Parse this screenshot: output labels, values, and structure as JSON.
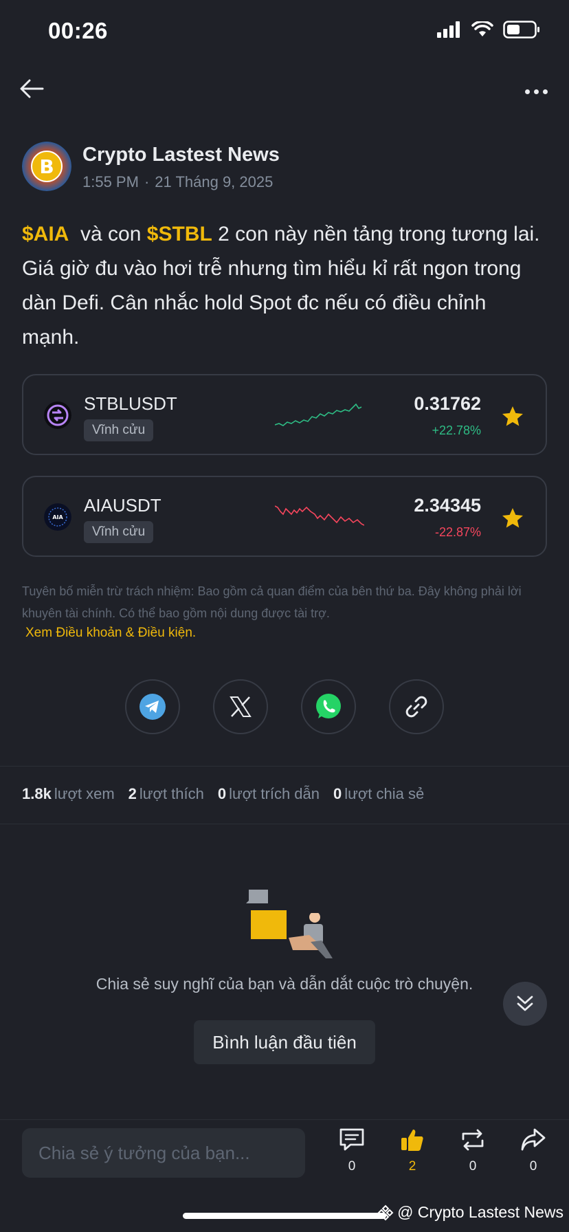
{
  "status_bar": {
    "time": "00:26"
  },
  "author": {
    "name": "Crypto Lastest News",
    "time": "1:55 PM",
    "date": "21 Tháng 9, 2025"
  },
  "post": {
    "tag1": "$AIA",
    "text1": "  và con ",
    "tag2": "$STBL",
    "text2": " 2 con này nền tảng trong tương lai. Giá giờ đu vào hơi trễ nhưng tìm hiểu kỉ rất ngon trong dàn Defi. Cân nhắc hold Spot đc nếu có điều chỉnh mạnh."
  },
  "tickers": [
    {
      "symbol": "STBLUSDT",
      "badge": "Vĩnh cửu",
      "price": "0.31762",
      "change": "+22.78%",
      "trend": "up"
    },
    {
      "symbol": "AIAUSDT",
      "badge": "Vĩnh cửu",
      "price": "2.34345",
      "change": "-22.87%",
      "trend": "down"
    }
  ],
  "disclaimer": "Tuyên bố miễn trừ trách nhiệm: Bao gồm cả quan điểm của bên thứ ba. Đây không phải lời khuyên tài chính. Có thể bao gồm nội dung được tài trợ.",
  "terms_link": "Xem Điều khoản & Điều kiện.",
  "stats": [
    {
      "count": "1.8k",
      "label": "lượt xem"
    },
    {
      "count": "2",
      "label": "lượt thích"
    },
    {
      "count": "0",
      "label": "lượt trích dẫn"
    },
    {
      "count": "0",
      "label": "lượt chia sẻ"
    }
  ],
  "comments_empty": {
    "text": "Chia sẻ suy nghĩ của bạn và dẫn dắt cuộc trò chuyện.",
    "button": "Bình luận đầu tiên"
  },
  "bottom_bar": {
    "input_placeholder": "Chia sẻ ý tưởng của bạn...",
    "comment_count": "0",
    "like_count": "2",
    "repost_count": "0",
    "share_count": "0"
  },
  "watermark": "@ Crypto Lastest News",
  "colors": {
    "accent": "#f0b90b",
    "up": "#2ebd85",
    "down": "#f6465d",
    "bg": "#1f2128"
  }
}
